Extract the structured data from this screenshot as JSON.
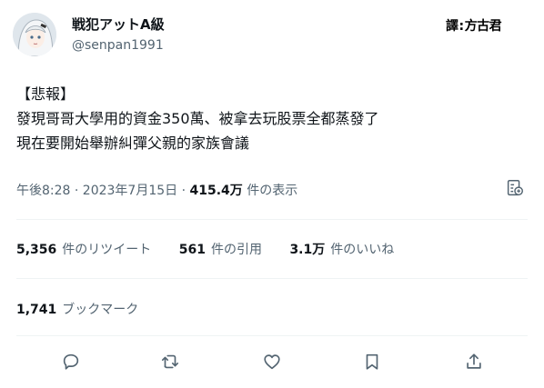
{
  "user": {
    "display_name": "戦犯アットA級",
    "handle": "@senpan1991",
    "avatar_icon": "anime-avatar-icon"
  },
  "watermark": {
    "prefix": "譯",
    "separator": ":",
    "name": "方古君"
  },
  "tweet": {
    "lines": [
      "【悲報】",
      "發現哥哥大學用的資金350萬、被拿去玩股票全都蒸發了",
      "現在要開始舉辦糾彈父親的家族會議"
    ]
  },
  "meta": {
    "timestamp": "午後8:28 · 2023年7月15日",
    "dot": "·",
    "views_value": "415.4万",
    "views_label": "件の表示"
  },
  "stats": {
    "retweets_value": "5,356",
    "retweets_label": "件のリツイート",
    "quotes_value": "561",
    "quotes_label": "件の引用",
    "likes_value": "3.1万",
    "likes_label": "件のいいね"
  },
  "bookmarks": {
    "value": "1,741",
    "label": "ブックマーク"
  },
  "actions": [
    {
      "icon": "reply-icon"
    },
    {
      "icon": "retweet-icon"
    },
    {
      "icon": "like-icon"
    },
    {
      "icon": "bookmark-icon"
    },
    {
      "icon": "share-icon"
    }
  ],
  "colors": {
    "text_primary": "#0f1419",
    "text_secondary": "#536471",
    "divider": "#eff3f4"
  }
}
